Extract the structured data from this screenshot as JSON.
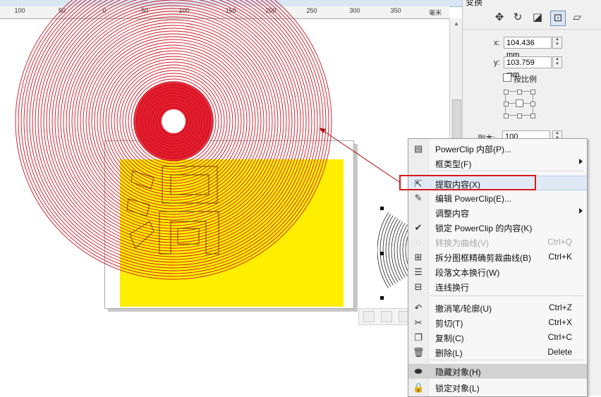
{
  "ruler": {
    "ticks": [
      "100",
      "50",
      "0",
      "50",
      "100",
      "150",
      "200",
      "250",
      "300",
      "350"
    ],
    "unit": "毫米"
  },
  "docker": {
    "title": "变换",
    "x_label": "x:",
    "x_value": "104.436 mm",
    "y_label": "y:",
    "y_value": "103.759 mm",
    "proportional_label": "按比例",
    "copies_label": "副本:",
    "copies_value": "100",
    "tabs": [
      "position-icon",
      "rotate-icon",
      "scale-mirror-icon",
      "size-icon",
      "skew-icon"
    ]
  },
  "context_menu": {
    "items": [
      {
        "label": "PowerClip 内部(P)...",
        "shortcut": "",
        "submenu": false,
        "icon": "powerclip-inside-icon",
        "state": "normal"
      },
      {
        "label": "框类型(F)",
        "shortcut": "",
        "submenu": true,
        "icon": "",
        "state": "normal"
      },
      {
        "label": "提取内容(X)",
        "shortcut": "",
        "submenu": false,
        "icon": "extract-content-icon",
        "state": "highlighted"
      },
      {
        "label": "编辑 PowerClip(E)...",
        "shortcut": "",
        "submenu": false,
        "icon": "edit-powerclip-icon",
        "state": "normal"
      },
      {
        "label": "调整内容",
        "shortcut": "",
        "submenu": true,
        "icon": "",
        "state": "normal"
      },
      {
        "label": "锁定 PowerClip 的内容(K)",
        "shortcut": "",
        "submenu": false,
        "icon": "checkmark-icon",
        "state": "normal"
      },
      {
        "label": "转换为曲线(V)",
        "shortcut": "Ctrl+Q",
        "submenu": false,
        "icon": "convert-to-curves-icon",
        "state": "disabled"
      },
      {
        "label": "拆分图框精确剪裁曲线(B)",
        "shortcut": "Ctrl+K",
        "submenu": false,
        "icon": "break-apart-icon",
        "state": "normal"
      },
      {
        "label": "段落文本换行(W)",
        "shortcut": "",
        "submenu": false,
        "icon": "text-wrap-icon",
        "state": "normal"
      },
      {
        "label": "连线换行",
        "shortcut": "",
        "submenu": false,
        "icon": "line-wrap-icon",
        "state": "normal"
      },
      {
        "label": "撤消笔/轮廓(U)",
        "shortcut": "Ctrl+Z",
        "submenu": false,
        "icon": "undo-icon",
        "state": "normal"
      },
      {
        "label": "剪切(T)",
        "shortcut": "Ctrl+X",
        "submenu": false,
        "icon": "scissors-icon",
        "state": "normal"
      },
      {
        "label": "复制(C)",
        "shortcut": "Ctrl+C",
        "submenu": false,
        "icon": "copy-icon",
        "state": "normal"
      },
      {
        "label": "删除(L)",
        "shortcut": "Delete",
        "submenu": false,
        "icon": "trash-icon",
        "state": "normal"
      },
      {
        "label": "隐藏对象(H)",
        "shortcut": "",
        "submenu": false,
        "icon": "hide-object-icon",
        "state": "gray"
      },
      {
        "label": "锁定对象(L)",
        "shortcut": "",
        "submenu": false,
        "icon": "lock-icon",
        "state": "normal"
      }
    ]
  },
  "canvas": {
    "ring_color": "#cc1422",
    "ring_center_color": "#e8051a",
    "fill_color": "#ffee00"
  }
}
